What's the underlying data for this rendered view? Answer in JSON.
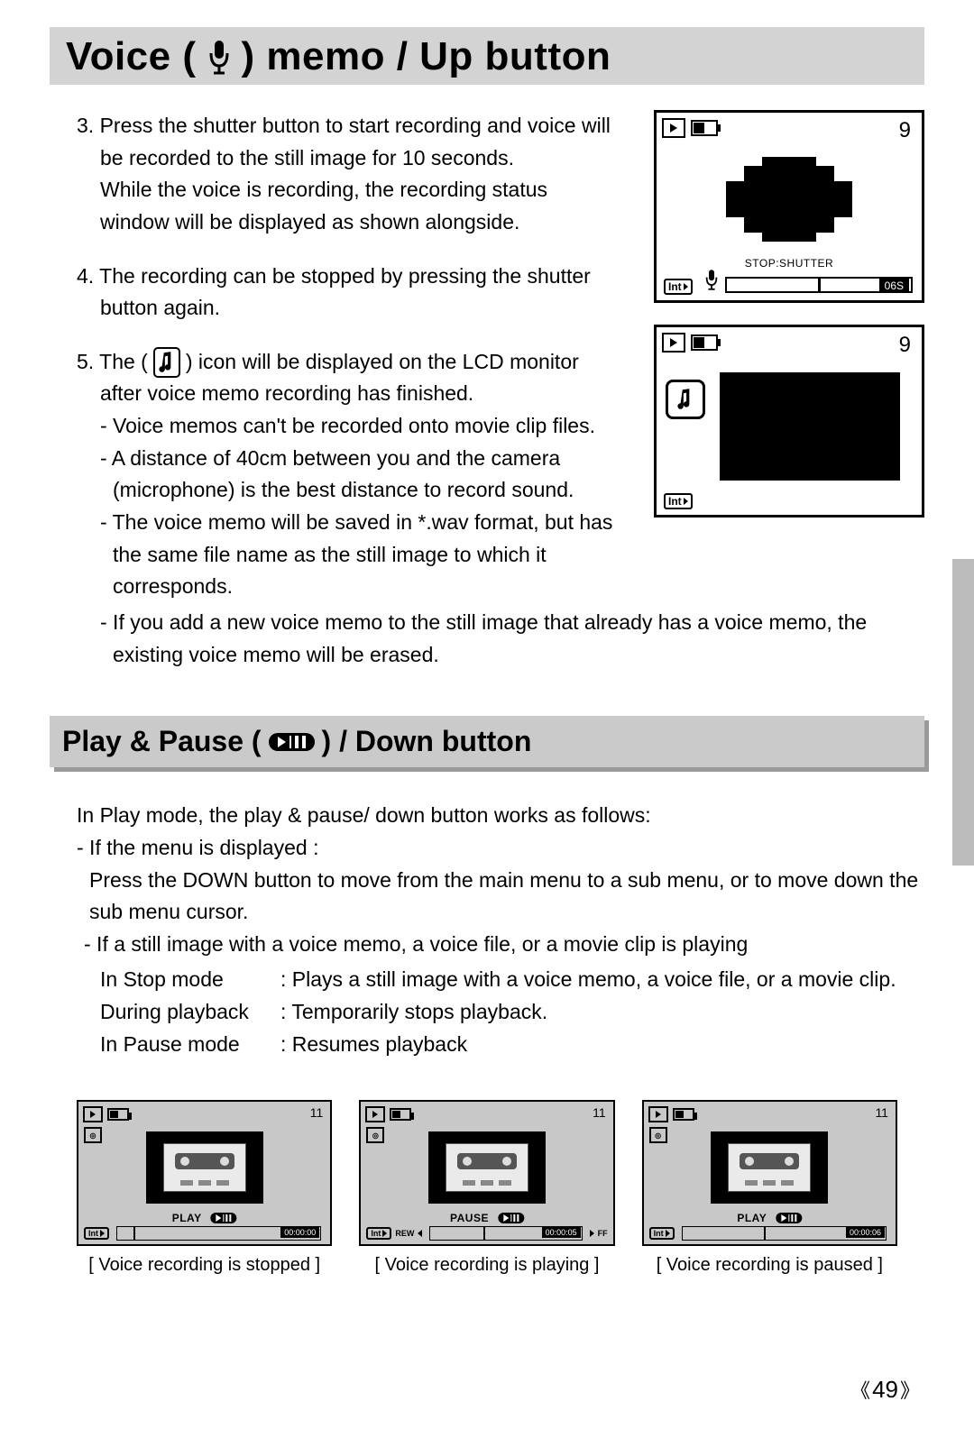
{
  "title": {
    "pre": "Voice (",
    "post": ") memo / Up button"
  },
  "steps": {
    "s3a": "3. Press the shutter button to start recording and voice will",
    "s3b": "be recorded to the still image for 10 seconds.",
    "s3c": "While the voice is recording, the recording status",
    "s3d": "window will be displayed as shown alongside.",
    "s4a": "4. The recording can be stopped by pressing the shutter",
    "s4b": "button again.",
    "s5a_pre": "5. The (",
    "s5a_post": ") icon will be displayed on the LCD monitor",
    "s5b": "after voice memo recording has finished.",
    "d1": "- Voice memos can't be recorded onto movie clip files.",
    "d2a": "- A distance of 40cm between you and the camera",
    "d2b": "(microphone) is the best distance to record sound.",
    "d3a": "- The voice memo will be saved in *.wav format, but has",
    "d3b": "the same file name as the still image to which it",
    "d3c": "corresponds.",
    "d4a": "- If you add a new voice memo to the still image that already has a voice memo, the",
    "d4b": "existing voice memo will be erased."
  },
  "lcd1": {
    "num": "9",
    "stop": "STOP:SHUTTER",
    "time": "06S",
    "int": "Int"
  },
  "lcd2": {
    "num": "9",
    "int": "Int"
  },
  "section2": {
    "pre": "Play & Pause (",
    "post": ") / Down button",
    "intro": "In Play mode, the play & pause/ down button works as follows:",
    "m1": "- If the menu is displayed :",
    "m1a": "Press the DOWN button to move from the main menu to a sub menu, or to move down the",
    "m1b": "sub menu cursor.",
    "m2": "- If a still image with a voice memo, a voice file, or a movie clip is playing",
    "r1k": "In Stop mode",
    "r1v": ": Plays a still image with a voice memo, a voice file, or a movie clip.",
    "r2k": "During playback",
    "r2v": ": Temporarily stops playback.",
    "r3k": "In Pause mode",
    "r3v": ": Resumes playback"
  },
  "thumbs": {
    "num": "11",
    "int": "Int",
    "t1": {
      "label": "PLAY",
      "time": "00:00:00",
      "caption": "[ Voice recording is stopped ]"
    },
    "t2": {
      "label": "PAUSE",
      "time": "00:00:05",
      "rew": "REW",
      "ff": "FF",
      "caption": "[ Voice recording is playing ]"
    },
    "t3": {
      "label": "PLAY",
      "time": "00:00:06",
      "caption": "[ Voice recording is paused ]"
    }
  },
  "pagenum": "49"
}
